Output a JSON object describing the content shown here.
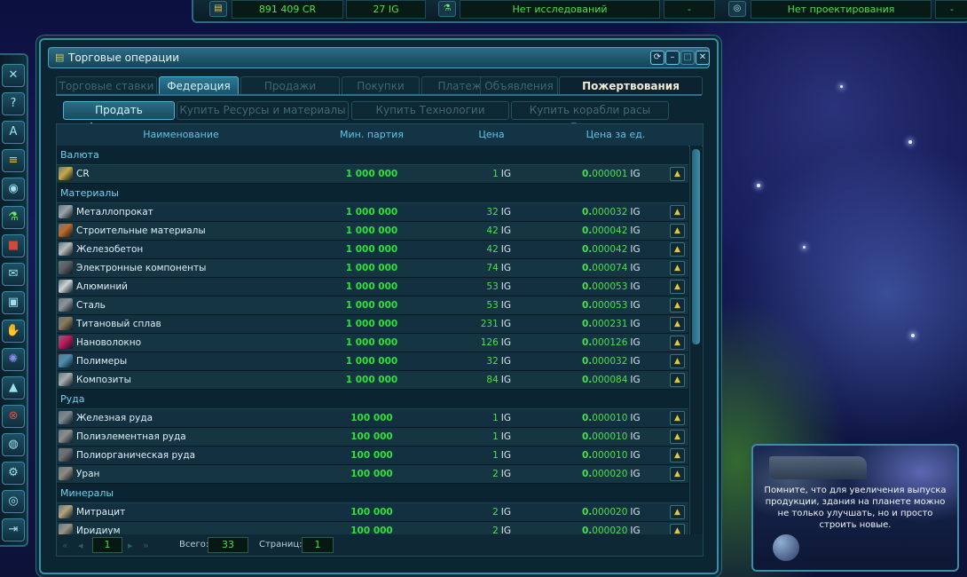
{
  "topbar": {
    "credits": "891 409 CR",
    "ig": "27 IG",
    "research_status": "Нет исследований",
    "research_extra": "-",
    "design_status": "Нет проектирования",
    "design_extra": "-"
  },
  "window": {
    "title": "Торговые операции",
    "tabs": [
      "Торговые ставки",
      "Федерация",
      "Продажи",
      "Покупки",
      "Платежи",
      "Объявления",
      "Пожертвования"
    ],
    "active_tab": "Федерация",
    "subtabs": [
      "Продать Федерации",
      "Купить Ресурсы и материалы",
      "Купить Технологии",
      "Купить корабли расы Боргов"
    ],
    "active_subtab": "Продать Федерации"
  },
  "grid": {
    "columns": [
      "Наименование",
      "Мин. партия",
      "Цена",
      "Цена за ед."
    ],
    "currency_suffix": "IG",
    "categories": [
      {
        "label": "Валюта",
        "items": [
          {
            "name": "CR",
            "qty": "1 000 000",
            "price": "1",
            "unit_lead": "0.",
            "unit_rest": "000001",
            "icon_color": "#c9a94a"
          }
        ]
      },
      {
        "label": "Материалы",
        "items": [
          {
            "name": "Металлопрокат",
            "qty": "1 000 000",
            "price": "32",
            "unit_lead": "0.",
            "unit_rest": "000032",
            "icon_color": "#9aa3a8"
          },
          {
            "name": "Строительные материалы",
            "qty": "1 000 000",
            "price": "42",
            "unit_lead": "0.",
            "unit_rest": "000042",
            "icon_color": "#c06a2a"
          },
          {
            "name": "Железобетон",
            "qty": "1 000 000",
            "price": "42",
            "unit_lead": "0.",
            "unit_rest": "000042",
            "icon_color": "#b9bcbc"
          },
          {
            "name": "Электронные компоненты",
            "qty": "1 000 000",
            "price": "74",
            "unit_lead": "0.",
            "unit_rest": "000074",
            "icon_color": "#5b5e60"
          },
          {
            "name": "Алюминий",
            "qty": "1 000 000",
            "price": "53",
            "unit_lead": "0.",
            "unit_rest": "000053",
            "icon_color": "#cfd3d6"
          },
          {
            "name": "Сталь",
            "qty": "1 000 000",
            "price": "53",
            "unit_lead": "0.",
            "unit_rest": "000053",
            "icon_color": "#8c9599"
          },
          {
            "name": "Титановый сплав",
            "qty": "1 000 000",
            "price": "231",
            "unit_lead": "0.",
            "unit_rest": "000231",
            "icon_color": "#8a7a5a"
          },
          {
            "name": "Нановолокно",
            "qty": "1 000 000",
            "price": "126",
            "unit_lead": "0.",
            "unit_rest": "000126",
            "icon_color": "#c2185b"
          },
          {
            "name": "Полимеры",
            "qty": "1 000 000",
            "price": "32",
            "unit_lead": "0.",
            "unit_rest": "000032",
            "icon_color": "#4d8fb0"
          },
          {
            "name": "Композиты",
            "qty": "1 000 000",
            "price": "84",
            "unit_lead": "0.",
            "unit_rest": "000084",
            "icon_color": "#a7adb0"
          }
        ]
      },
      {
        "label": "Руда",
        "items": [
          {
            "name": "Железная руда",
            "qty": "100 000",
            "price": "1",
            "unit_lead": "0.",
            "unit_rest": "000010",
            "icon_color": "#7f8a90"
          },
          {
            "name": "Полиэлементная руда",
            "qty": "100 000",
            "price": "1",
            "unit_lead": "0.",
            "unit_rest": "000010",
            "icon_color": "#8d8d8d"
          },
          {
            "name": "Полиорганическая руда",
            "qty": "100 000",
            "price": "1",
            "unit_lead": "0.",
            "unit_rest": "000010",
            "icon_color": "#6e6e6e"
          },
          {
            "name": "Уран",
            "qty": "100 000",
            "price": "2",
            "unit_lead": "0.",
            "unit_rest": "000020",
            "icon_color": "#8f8a80"
          }
        ]
      },
      {
        "label": "Минералы",
        "items": [
          {
            "name": "Митрацит",
            "qty": "100 000",
            "price": "2",
            "unit_lead": "0.",
            "unit_rest": "000020",
            "icon_color": "#b6a37c"
          },
          {
            "name": "Иридиум",
            "qty": "100 000",
            "price": "2",
            "unit_lead": "0.",
            "unit_rest": "000020",
            "icon_color": "#9c9488"
          }
        ]
      }
    ]
  },
  "pager": {
    "page": "1",
    "total_label": "Всего:",
    "total": "33",
    "pages_label": "Страниц:",
    "pages": "1"
  },
  "tip": {
    "text": "Помните, что для увеличения выпуска продукции, здания на планете можно не только улучшать, но и просто строить новые."
  },
  "colors": {
    "accent": "#3c8ea6",
    "value_green": "#4be04b",
    "category_text": "#6fd3ee"
  }
}
